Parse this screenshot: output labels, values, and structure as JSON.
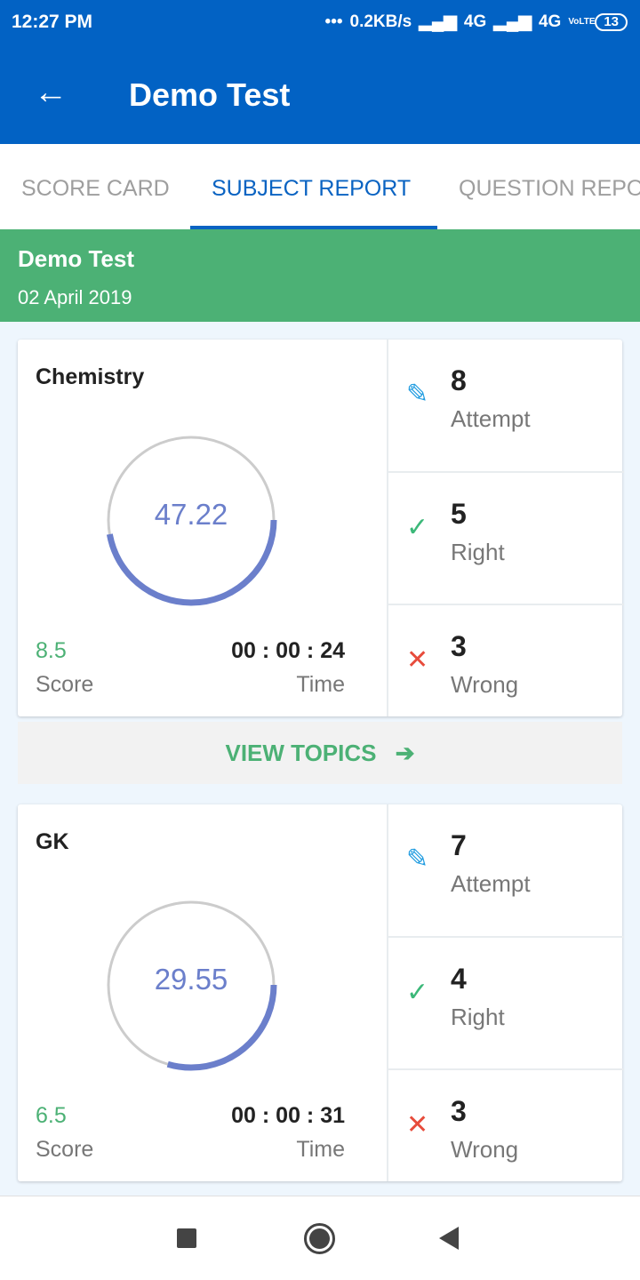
{
  "status": {
    "time": "12:27 PM",
    "dots": "•••",
    "speed": "0.2KB/s",
    "net1": "4G",
    "net2": "4G",
    "volte": "VoLTE",
    "battery": "13"
  },
  "appbar": {
    "title": "Demo Test"
  },
  "tabs": [
    {
      "label": "SCORE CARD"
    },
    {
      "label": "SUBJECT REPORT",
      "active": true
    },
    {
      "label": "QUESTION REPORT"
    }
  ],
  "banner": {
    "title": "Demo Test",
    "date": "02 April 2019"
  },
  "colors": {
    "primary": "#0262c4",
    "green": "#4cb175",
    "ring": "#6b7fcb",
    "wrong": "#e74c3c"
  },
  "subjects": [
    {
      "name": "Chemistry",
      "percent": "47.22",
      "percent_value": 47.22,
      "score": "8.5",
      "score_label": "Score",
      "time": "00 : 00 : 24",
      "time_label": "Time",
      "attempt": "8",
      "attempt_label": "Attempt",
      "right": "5",
      "right_label": "Right",
      "wrong": "3",
      "wrong_label": "Wrong"
    },
    {
      "name": "GK",
      "percent": "29.55",
      "percent_value": 29.55,
      "score": "6.5",
      "score_label": "Score",
      "time": "00 : 00 : 31",
      "time_label": "Time",
      "attempt": "7",
      "attempt_label": "Attempt",
      "right": "4",
      "right_label": "Right",
      "wrong": "3",
      "wrong_label": "Wrong"
    }
  ],
  "view_topics": "VIEW TOPICS",
  "icons": {
    "back": "arrow-left-icon",
    "attempt": "pencil-icon",
    "right": "check-icon",
    "wrong": "x-icon",
    "topics": "arrow-right-icon"
  }
}
